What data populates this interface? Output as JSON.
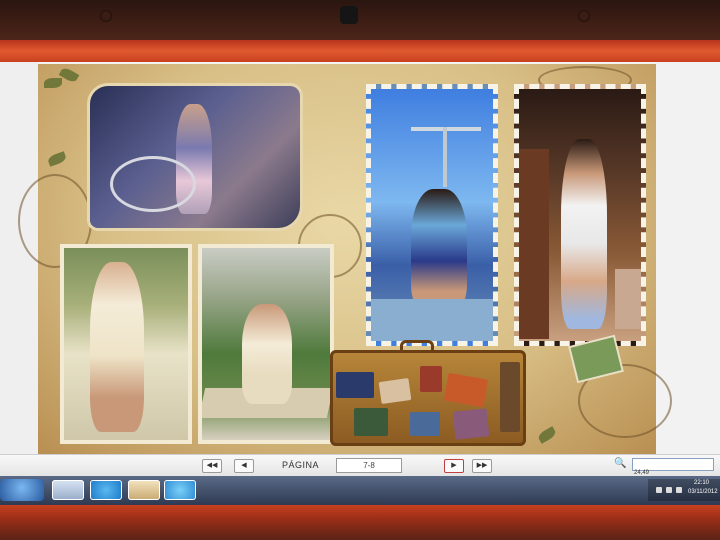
{
  "viewer": {
    "page_label": "PÁGINA",
    "page_value": "7-8",
    "zoom_value": "24,49"
  },
  "taskbar": {
    "items": [
      "media-player",
      "folder",
      "skype",
      "image-viewer",
      "internet-explorer"
    ],
    "clock_time": "22:10",
    "clock_date": "03/11/2012"
  },
  "album": {
    "accent_colors": [
      "#d8bf86",
      "#b98f52",
      "#5c6b2e"
    ],
    "photos": [
      "girl-with-bicycle",
      "girl-in-garden",
      "girl-on-picnic-blanket",
      "girl-doing-high-kick",
      "girl-pointing-up-indoors"
    ]
  }
}
